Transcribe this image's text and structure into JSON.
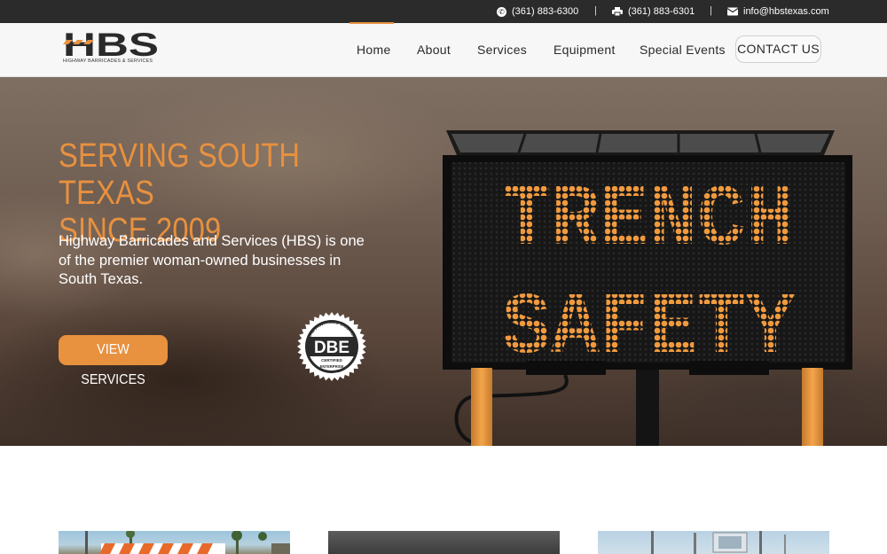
{
  "topbar": {
    "phone": "(361) 883-6300",
    "fax": "(361) 883-6301",
    "email": "info@hbstexas.com",
    "separator": "|"
  },
  "logo": {
    "mark": "HBS",
    "subtitle": "HIGHWAY BARRICADES & SERVICES"
  },
  "nav": {
    "items": [
      {
        "label": "Home"
      },
      {
        "label": "About"
      },
      {
        "label": "Services"
      },
      {
        "label": "Equipment"
      },
      {
        "label": "Special Events"
      }
    ],
    "contact_label": "CONTACT US"
  },
  "hero": {
    "title_line1": "SERVING SOUTH TEXAS",
    "title_line2": "SINCE 2009",
    "text": "Highway Barricades and Services (HBS) is one of the premier woman-owned businesses in South Texas.",
    "button_label": "VIEW SERVICES",
    "badge": {
      "main": "DBE",
      "ring": "DISADVANTAGED BUSINESS",
      "sub": "CERTIFIED",
      "bottom": "ENTERPRISE"
    },
    "sign_line1": "TRENCH",
    "sign_line2": "SAFETY"
  },
  "colors": {
    "accent": "#e8913f",
    "topbar": "#2b2b2b",
    "nav_bg": "#f7f7f7"
  }
}
